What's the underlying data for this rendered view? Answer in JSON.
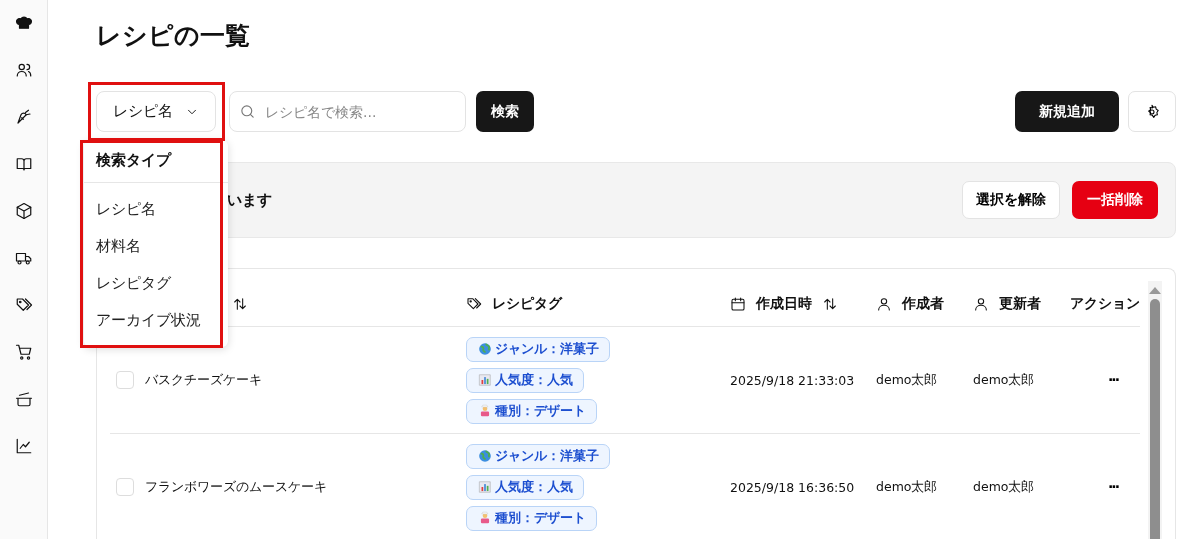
{
  "page": {
    "title": "レシピの一覧"
  },
  "toolbar": {
    "search_type": "レシピ名",
    "search": {
      "placeholder": "レシピ名で検索..."
    },
    "search_button": "検索",
    "add_button": "新規追加"
  },
  "search_type_menu": {
    "header": "検索タイプ",
    "options": [
      "レシピ名",
      "材料名",
      "レシピタグ",
      "アーカイブ状況"
    ]
  },
  "selection_bar": {
    "text": "います",
    "clear_button": "選択を解除",
    "delete_button": "一括削除"
  },
  "table": {
    "columns": [
      {
        "kind": "sort-only"
      },
      {
        "kind": "tag",
        "label": "レシピタグ"
      },
      {
        "kind": "date",
        "label": "作成日時"
      },
      {
        "kind": "user",
        "label": "作成者"
      },
      {
        "kind": "user",
        "label": "更新者"
      },
      {
        "kind": "plain",
        "label": "アクション"
      }
    ],
    "rows": [
      {
        "checked": false,
        "name": "バスクチーズケーキ",
        "tags": [
          {
            "kind": "genre",
            "text": "ジャンル：洋菓子"
          },
          {
            "kind": "popularity",
            "text": "人気度：人気"
          },
          {
            "kind": "category",
            "text": "種別：デザート"
          }
        ],
        "created_at": "2025/9/18 21:33:03",
        "creator": "demo太郎",
        "updater": "demo太郎",
        "action": "···"
      },
      {
        "checked": false,
        "name": "フランボワーズのムースケーキ",
        "tags": [
          {
            "kind": "genre",
            "text": "ジャンル：洋菓子"
          },
          {
            "kind": "popularity",
            "text": "人気度：人気"
          },
          {
            "kind": "category",
            "text": "種別：デザート"
          }
        ],
        "created_at": "2025/9/18 16:36:50",
        "creator": "demo太郎",
        "updater": "demo太郎",
        "action": "···"
      }
    ]
  }
}
